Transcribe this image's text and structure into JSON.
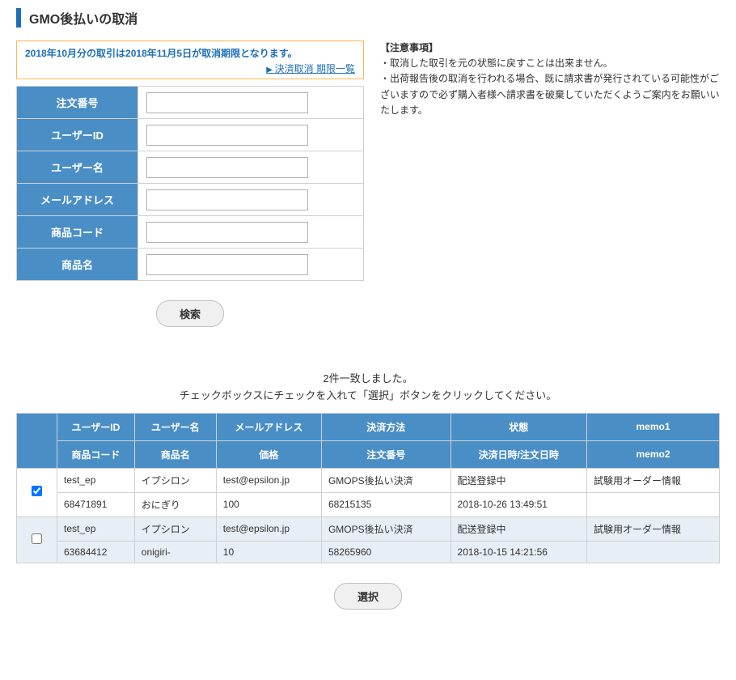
{
  "pageTitle": "GMO後払いの取消",
  "notice": {
    "text": "2018年10月分の取引は2018年11月5日が取消期限となります。",
    "link": "決済取消 期限一覧"
  },
  "caution": {
    "title": "【注意事項】",
    "line1": "・取消した取引を元の状態に戻すことは出来ません。",
    "line2": "・出荷報告後の取消を行われる場合、既に請求書が発行されている可能性がございますので必ず購入者様へ請求書を破棄していただくようご案内をお願いいたします。"
  },
  "form": {
    "orderNo": {
      "label": "注文番号",
      "value": ""
    },
    "userId": {
      "label": "ユーザーID",
      "value": ""
    },
    "userName": {
      "label": "ユーザー名",
      "value": ""
    },
    "email": {
      "label": "メールアドレス",
      "value": ""
    },
    "productCode": {
      "label": "商品コード",
      "value": ""
    },
    "productName": {
      "label": "商品名",
      "value": ""
    }
  },
  "searchButton": "検索",
  "result": {
    "countMsg": "2件一致しました。",
    "instructionMsg": "チェックボックスにチェックを入れて「選択」ボタンをクリックしてください。"
  },
  "tableHeaders": {
    "row1": {
      "userId": "ユーザーID",
      "userName": "ユーザー名",
      "email": "メールアドレス",
      "payMethod": "決済方法",
      "status": "状態",
      "memo1": "memo1"
    },
    "row2": {
      "productCode": "商品コード",
      "productName": "商品名",
      "price": "価格",
      "orderNo": "注文番号",
      "payDate": "決済日時/注文日時",
      "memo2": "memo2"
    }
  },
  "rows": [
    {
      "checked": true,
      "userId": "test_ep",
      "userName": "イプシロン",
      "email": "test@epsilon.jp",
      "payMethod": "GMOPS後払い決済",
      "status": "配送登録中",
      "memo1": "試験用オーダー情報",
      "productCode": "68471891",
      "productName": "おにぎり",
      "price": "100",
      "orderNo": "68215135",
      "payDate": "2018-10-26 13:49:51",
      "memo2": ""
    },
    {
      "checked": false,
      "userId": "test_ep",
      "userName": "イプシロン",
      "email": "test@epsilon.jp",
      "payMethod": "GMOPS後払い決済",
      "status": "配送登録中",
      "memo1": "試験用オーダー情報",
      "productCode": "63684412",
      "productName": "onigiri-",
      "price": "10",
      "orderNo": "58265960",
      "payDate": "2018-10-15 14:21:56",
      "memo2": ""
    }
  ],
  "selectButton": "選択"
}
